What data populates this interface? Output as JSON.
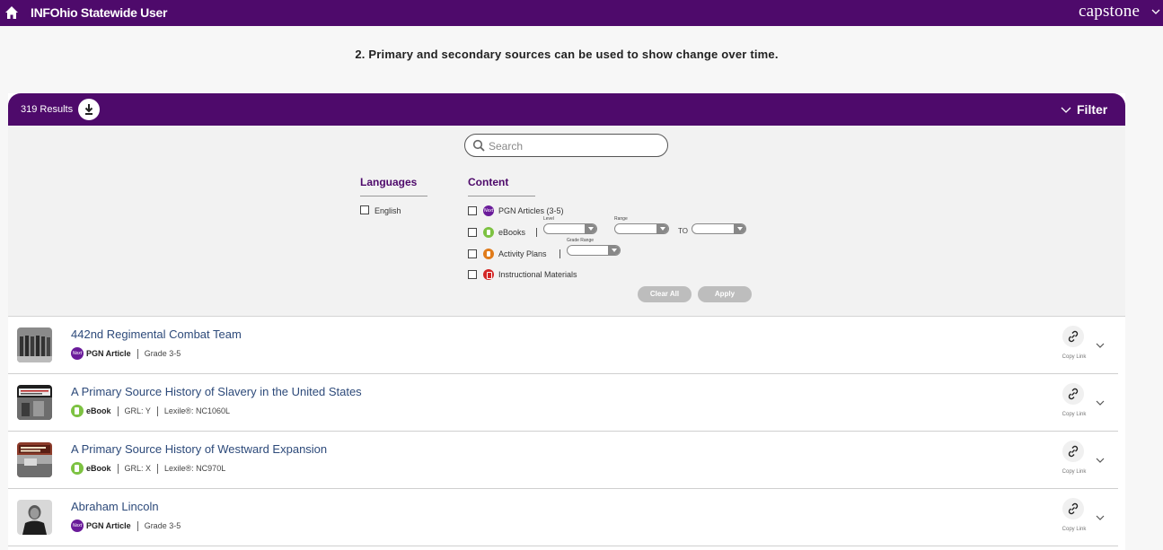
{
  "topbar": {
    "user_label": "INFOhio Statewide User",
    "brand": "capstone"
  },
  "standard_text": "2. Primary and secondary sources can be used to show change over time.",
  "results": {
    "count_label": "319 Results",
    "filter_label": "Filter"
  },
  "filters": {
    "search_placeholder": "Search",
    "languages_heading": "Languages",
    "language_options": [
      {
        "label": "English",
        "checked": false
      }
    ],
    "content_heading": "Content",
    "content_options": [
      {
        "label": "PGN Articles (3-5)",
        "icon": "next-badge-icon",
        "checked": false
      },
      {
        "label": "eBooks",
        "icon": "ebook-icon",
        "checked": false
      },
      {
        "label": "Activity Plans",
        "icon": "activity-plan-icon",
        "checked": false
      },
      {
        "label": "Instructional Materials",
        "icon": "instructional-materials-icon",
        "checked": false
      }
    ],
    "ebook_level_label": "Level",
    "ebook_range_label": "Range",
    "ebook_to_label": "TO",
    "activity_grade_range_label": "Grade Range",
    "clear_all_label": "Clear All",
    "apply_label": "Apply"
  },
  "rows": [
    {
      "title": "442nd Regimental Combat Team",
      "badge": "Next",
      "type": "PGN Article",
      "meta": [
        "Grade 3-5"
      ],
      "copy_label": "Copy Link"
    },
    {
      "title": "A Primary Source History of Slavery in the United States",
      "badge": "",
      "type": "eBook",
      "meta": [
        "GRL: Y",
        "Lexile®: NC1060L"
      ],
      "copy_label": "Copy Link"
    },
    {
      "title": "A Primary Source History of Westward Expansion",
      "badge": "",
      "type": "eBook",
      "meta": [
        "GRL: X",
        "Lexile®: NC970L"
      ],
      "copy_label": "Copy Link"
    },
    {
      "title": "Abraham Lincoln",
      "badge": "Next",
      "type": "PGN Article",
      "meta": [
        "Grade 3-5"
      ],
      "copy_label": "Copy Link"
    }
  ],
  "colors": {
    "brand_purple": "#4e0a6b",
    "title_blue": "#2d4a7a",
    "ebook_green": "#7dc242",
    "activity_orange": "#e07b1a",
    "instructional_red": "#d32626"
  }
}
